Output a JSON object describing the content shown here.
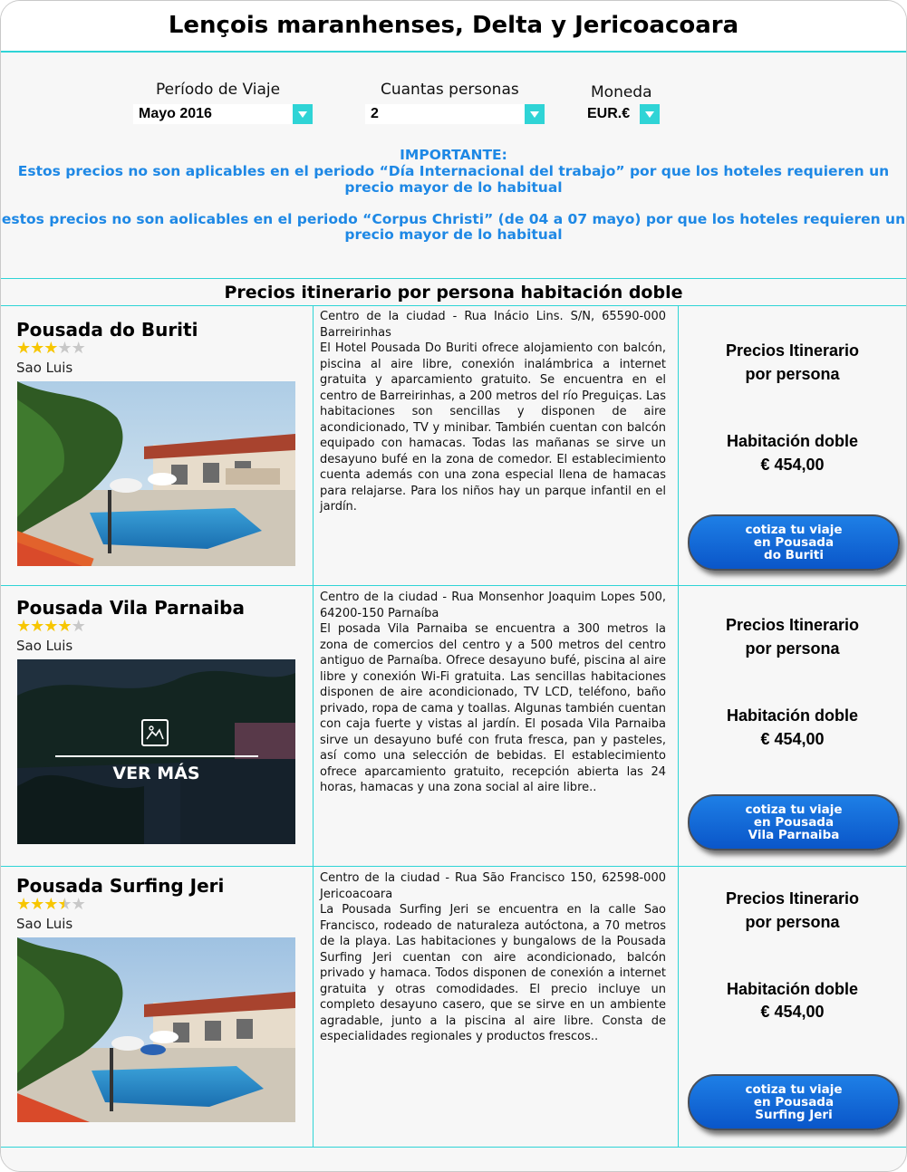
{
  "page": {
    "title": "Lençois maranhenses, Delta y Jericoacoara"
  },
  "filters": {
    "period": {
      "label": "Período de Viaje",
      "value": "Mayo 2016"
    },
    "persons": {
      "label": "Cuantas personas",
      "value": "2"
    },
    "currency": {
      "label": "Moneda",
      "value": "EUR.€"
    }
  },
  "notice": {
    "heading": "IMPORTANTE:",
    "line1a": "Estos precios no son aplicables en el periodo “Día Internacional del trabajo” por que los hoteles requieren un",
    "line1b": "precio mayor de lo habitual",
    "line2a": "estos precios no son aolicables en el periodo “Corpus Christi” (de 04 a 07 mayo) por que los hoteles requieren un",
    "line2b": "precio mayor de lo habitual"
  },
  "section_title": "Precios itinerario por persona habitación doble",
  "colors": {
    "accent": "#2fd4d6",
    "notice": "#1e88e5",
    "cta": "#0a56c9",
    "star": "#f7c600"
  },
  "hotels": [
    {
      "name": "Pousada do Buriti",
      "rating": 3,
      "city": "Sao Luis",
      "address": "Centro de la ciudad - Rua Inácio Lins. S/N, 65590-000 Barreirinhas",
      "description": "El Hotel Pousada Do Buriti ofrece alojamiento con balcón, piscina al aire libre, conexión inalámbrica a internet gratuita y aparcamiento gratuito. Se encuentra en el centro de Barreirinhas, a 200 metros del río Preguiças. Las habitaciones son sencillas y disponen de aire acondicionado, TV y minibar. También cuentan con balcón equipado con hamacas. Todas las mañanas se sirve un desayuno bufé en la zona de comedor. El establecimiento cuenta además con una zona especial llena de hamacas para relajarse. Para los niños hay un parque infantil en el jardín.",
      "price_heading_1": "Precios Itinerario",
      "price_heading_2": "por persona",
      "room_type": "Habitación doble",
      "price": "€ 454,00",
      "cta_1": "cotiza tu viaje",
      "cta_2": "en Pousada",
      "cta_3": "do Buriti"
    },
    {
      "name": "Pousada Vila Parnaiba",
      "rating": 4,
      "city": "Sao Luis",
      "address": "Centro de la ciudad - Rua Monsenhor Joaquim Lopes 500, 64200-150 Parnaíba",
      "description": "El posada Vila Parnaiba se encuentra a 300 metros la zona de comercios del centro y a 500 metros del centro antiguo de Parnaíba. Ofrece desayuno bufé, piscina al aire libre y conexión Wi-Fi gratuita. Las sencillas habitaciones disponen de aire acondicionado, TV LCD, teléfono, baño privado, ropa de cama y toallas. Algunas también cuentan con caja fuerte y vistas al jardín. El posada Vila Parnaiba sirve un desayuno bufé con fruta fresca, pan y pasteles, así como una selección de bebidas. El establecimiento ofrece aparcamiento gratuito, recepción abierta las 24 horas, hamacas y una zona social al aire libre..",
      "overlay_label": "VER MÁS",
      "price_heading_1": "Precios Itinerario",
      "price_heading_2": "por persona",
      "room_type": "Habitación doble",
      "price": "€ 454,00",
      "cta_1": "cotiza tu viaje",
      "cta_2": "en Pousada",
      "cta_3": "Vila Parnaiba"
    },
    {
      "name": "Pousada Surfing Jeri",
      "rating": 3.5,
      "city": "Sao Luis",
      "address": "Centro de la ciudad - Rua São Francisco 150, 62598-000 Jericoacoara",
      "description": "La Pousada Surfing Jeri se encuentra en la calle Sao Francisco, rodeado de naturaleza autóctona, a 70 metros de la playa. Las habitaciones y bungalows de la Pousada Surfing Jeri cuentan con aire acondicionado, balcón privado y hamaca. Todos disponen de conexión a internet gratuita y otras comodidades. El precio incluye un completo desayuno casero, que se sirve en un ambiente agradable, junto a la piscina al aire libre. Consta de especialidades regionales y productos frescos..",
      "price_heading_1": "Precios Itinerario",
      "price_heading_2": "por persona",
      "room_type": "Habitación doble",
      "price": "€ 454,00",
      "cta_1": "cotiza tu viaje",
      "cta_2": "en Pousada",
      "cta_3": "Surfing Jeri"
    }
  ]
}
